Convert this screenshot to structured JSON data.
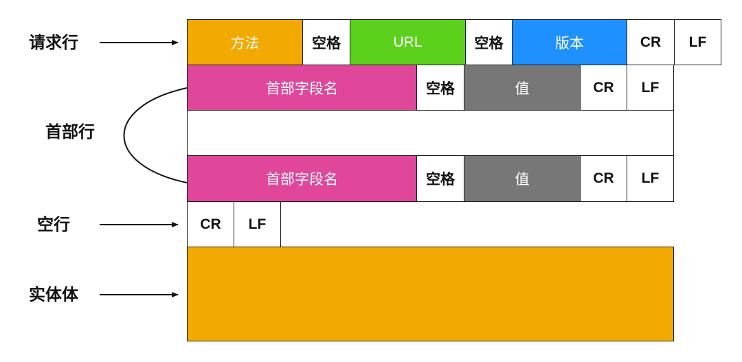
{
  "labels": {
    "request_line": "请求行",
    "header_lines": "首部行",
    "blank_line": "空行",
    "entity_body": "实体体"
  },
  "request_line": {
    "method": "方法",
    "space1": "空格",
    "url": "URL",
    "space2": "空格",
    "version": "版本",
    "cr": "CR",
    "lf": "LF"
  },
  "header_line_1": {
    "field_name": "首部字段名",
    "space": "空格",
    "value": "值",
    "cr": "CR",
    "lf": "LF"
  },
  "header_line_2": {
    "field_name": "首部字段名",
    "space": "空格",
    "value": "值",
    "cr": "CR",
    "lf": "LF"
  },
  "blank_line": {
    "cr": "CR",
    "lf": "LF"
  },
  "entity_body": {
    "text": ""
  },
  "colors": {
    "method": "#F2A900",
    "url": "#5CD11C",
    "version": "#1E90FF",
    "field_name": "#E0479A",
    "value": "#777777",
    "entity_body": "#F2A900"
  }
}
